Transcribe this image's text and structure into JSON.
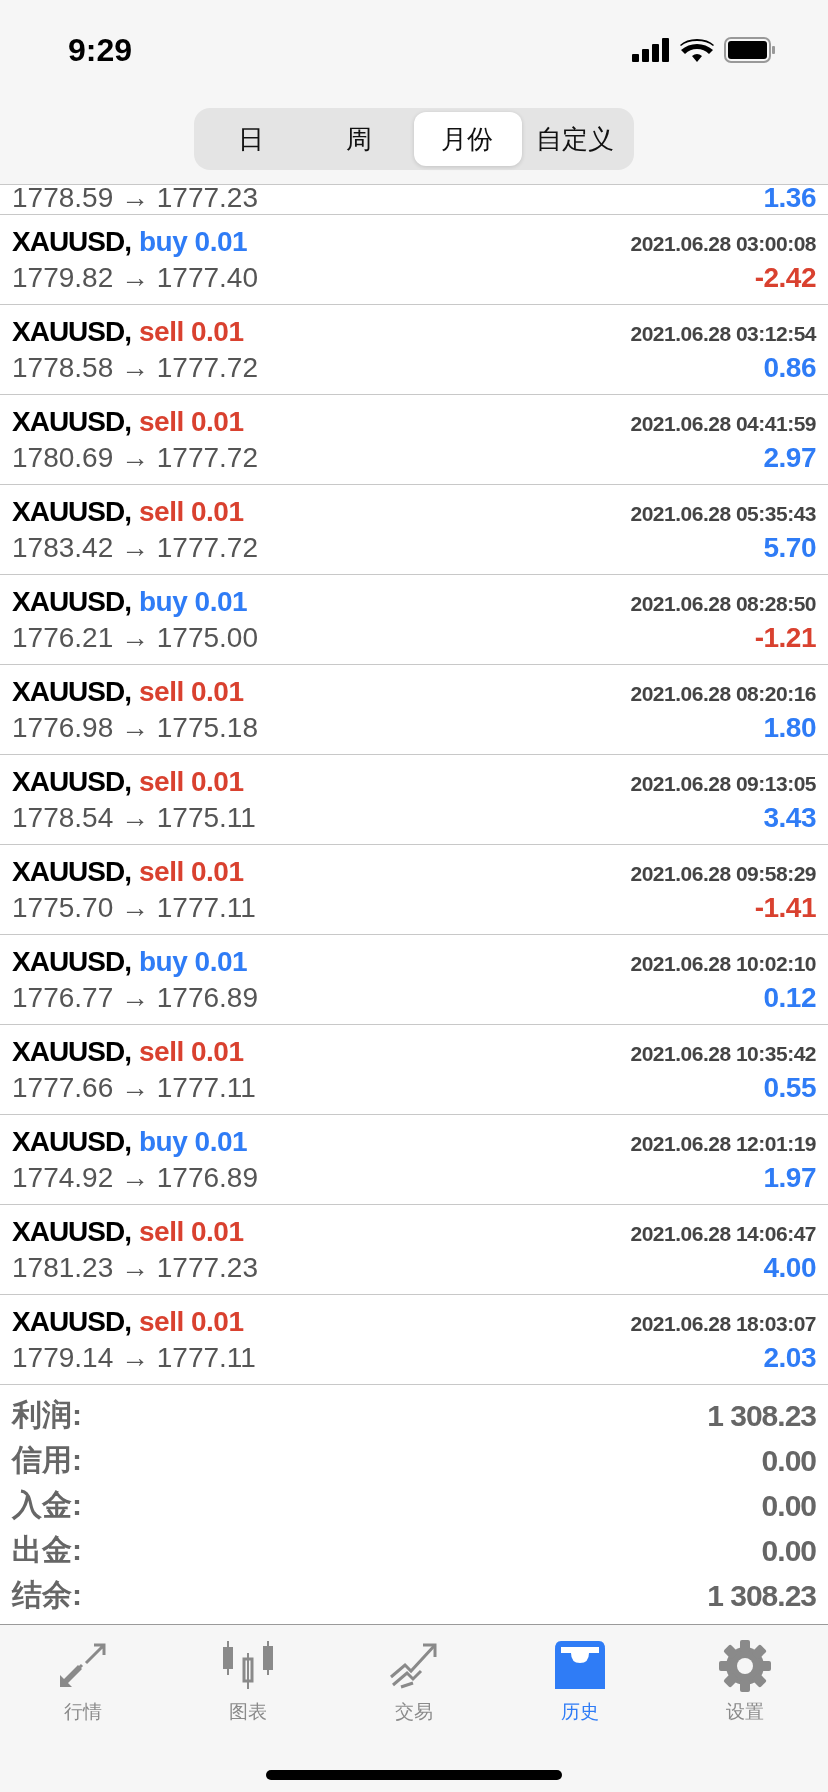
{
  "status_bar": {
    "time": "9:29"
  },
  "segments": [
    {
      "label": "日",
      "selected": false
    },
    {
      "label": "周",
      "selected": false
    },
    {
      "label": "月份",
      "selected": true
    },
    {
      "label": "自定义",
      "selected": false
    }
  ],
  "partial_row": {
    "prices": "1778.59 → 1777.23",
    "profit": {
      "text": "1.36",
      "color": "#2f7cf6"
    }
  },
  "deals": [
    {
      "symbol": "XAUUSD,",
      "order": {
        "text": "buy 0.01",
        "color": "#2f7cf6"
      },
      "time": "2021.06.28 03:00:08",
      "prices": "1779.82 → 1777.40",
      "profit": {
        "text": "-2.42",
        "color": "#d9412f"
      }
    },
    {
      "symbol": "XAUUSD,",
      "order": {
        "text": "sell 0.01",
        "color": "#d9412f"
      },
      "time": "2021.06.28 03:12:54",
      "prices": "1778.58 → 1777.72",
      "profit": {
        "text": "0.86",
        "color": "#2f7cf6"
      }
    },
    {
      "symbol": "XAUUSD,",
      "order": {
        "text": "sell 0.01",
        "color": "#d9412f"
      },
      "time": "2021.06.28 04:41:59",
      "prices": "1780.69 → 1777.72",
      "profit": {
        "text": "2.97",
        "color": "#2f7cf6"
      }
    },
    {
      "symbol": "XAUUSD,",
      "order": {
        "text": "sell 0.01",
        "color": "#d9412f"
      },
      "time": "2021.06.28 05:35:43",
      "prices": "1783.42 → 1777.72",
      "profit": {
        "text": "5.70",
        "color": "#2f7cf6"
      }
    },
    {
      "symbol": "XAUUSD,",
      "order": {
        "text": "buy 0.01",
        "color": "#2f7cf6"
      },
      "time": "2021.06.28 08:28:50",
      "prices": "1776.21 → 1775.00",
      "profit": {
        "text": "-1.21",
        "color": "#d9412f"
      }
    },
    {
      "symbol": "XAUUSD,",
      "order": {
        "text": "sell 0.01",
        "color": "#d9412f"
      },
      "time": "2021.06.28 08:20:16",
      "prices": "1776.98 → 1775.18",
      "profit": {
        "text": "1.80",
        "color": "#2f7cf6"
      }
    },
    {
      "symbol": "XAUUSD,",
      "order": {
        "text": "sell 0.01",
        "color": "#d9412f"
      },
      "time": "2021.06.28 09:13:05",
      "prices": "1778.54 → 1775.11",
      "profit": {
        "text": "3.43",
        "color": "#2f7cf6"
      }
    },
    {
      "symbol": "XAUUSD,",
      "order": {
        "text": "sell 0.01",
        "color": "#d9412f"
      },
      "time": "2021.06.28 09:58:29",
      "prices": "1775.70 → 1777.11",
      "profit": {
        "text": "-1.41",
        "color": "#d9412f"
      }
    },
    {
      "symbol": "XAUUSD,",
      "order": {
        "text": "buy 0.01",
        "color": "#2f7cf6"
      },
      "time": "2021.06.28 10:02:10",
      "prices": "1776.77 → 1776.89",
      "profit": {
        "text": "0.12",
        "color": "#2f7cf6"
      }
    },
    {
      "symbol": "XAUUSD,",
      "order": {
        "text": "sell 0.01",
        "color": "#d9412f"
      },
      "time": "2021.06.28 10:35:42",
      "prices": "1777.66 → 1777.11",
      "profit": {
        "text": "0.55",
        "color": "#2f7cf6"
      }
    },
    {
      "symbol": "XAUUSD,",
      "order": {
        "text": "buy 0.01",
        "color": "#2f7cf6"
      },
      "time": "2021.06.28 12:01:19",
      "prices": "1774.92 → 1776.89",
      "profit": {
        "text": "1.97",
        "color": "#2f7cf6"
      }
    },
    {
      "symbol": "XAUUSD,",
      "order": {
        "text": "sell 0.01",
        "color": "#d9412f"
      },
      "time": "2021.06.28 14:06:47",
      "prices": "1781.23 → 1777.23",
      "profit": {
        "text": "4.00",
        "color": "#2f7cf6"
      }
    },
    {
      "symbol": "XAUUSD,",
      "order": {
        "text": "sell 0.01",
        "color": "#d9412f"
      },
      "time": "2021.06.28 18:03:07",
      "prices": "1779.14 → 1777.11",
      "profit": {
        "text": "2.03",
        "color": "#2f7cf6"
      }
    }
  ],
  "summary": [
    {
      "label": "利润:",
      "value": "1 308.23"
    },
    {
      "label": "信用:",
      "value": "0.00"
    },
    {
      "label": "入金:",
      "value": "0.00"
    },
    {
      "label": "出金:",
      "value": "0.00"
    },
    {
      "label": "结余:",
      "value": "1 308.23"
    }
  ],
  "tab_bar": [
    {
      "kind": "quotes",
      "label": "行情",
      "selected": false
    },
    {
      "kind": "chart",
      "label": "图表",
      "selected": false
    },
    {
      "kind": "trade",
      "label": "交易",
      "selected": false
    },
    {
      "kind": "history",
      "label": "历史",
      "selected": true
    },
    {
      "kind": "settings",
      "label": "设置",
      "selected": false
    }
  ]
}
